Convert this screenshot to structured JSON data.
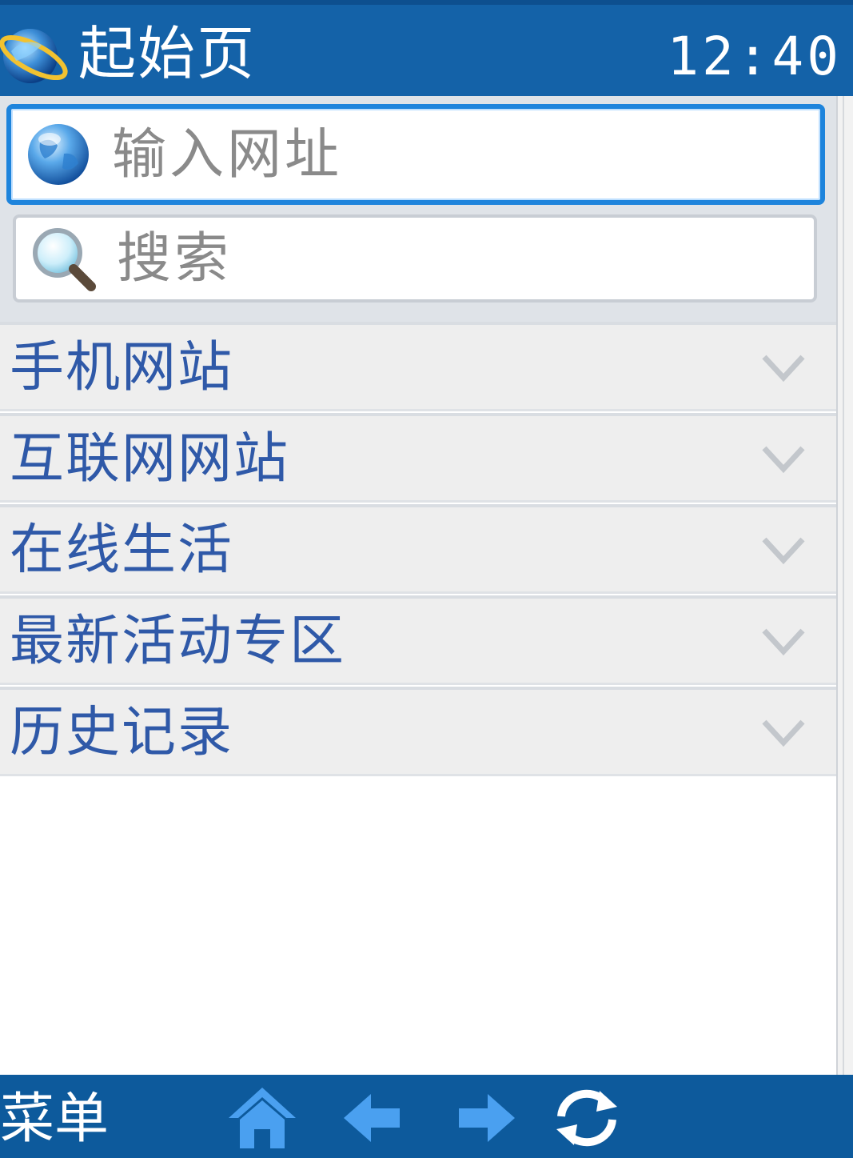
{
  "header": {
    "title": "起始页",
    "time": "12:40",
    "logo_icon": "browser-globe-icon"
  },
  "address_bar": {
    "placeholder": "输入网址",
    "icon": "globe-icon",
    "focused": true
  },
  "search_bar": {
    "placeholder": "搜索",
    "icon": "magnifier-icon"
  },
  "sections": [
    {
      "label": "手机网站",
      "icon": "chevron-down-icon"
    },
    {
      "label": "互联网网站",
      "icon": "chevron-down-icon"
    },
    {
      "label": "在线生活",
      "icon": "chevron-down-icon"
    },
    {
      "label": "最新活动专区",
      "icon": "chevron-down-icon"
    },
    {
      "label": "历史记录",
      "icon": "chevron-down-icon"
    }
  ],
  "toolbar": {
    "menu_label": "菜单",
    "buttons": [
      "home-icon",
      "back-arrow-icon",
      "forward-arrow-icon",
      "refresh-icon"
    ]
  },
  "colors": {
    "title_bar": "#1462a8",
    "toolbar": "#0d5a9c",
    "focus_border": "#1e84dc",
    "section_text": "#2f59a8",
    "section_bg": "#eeeeee"
  }
}
